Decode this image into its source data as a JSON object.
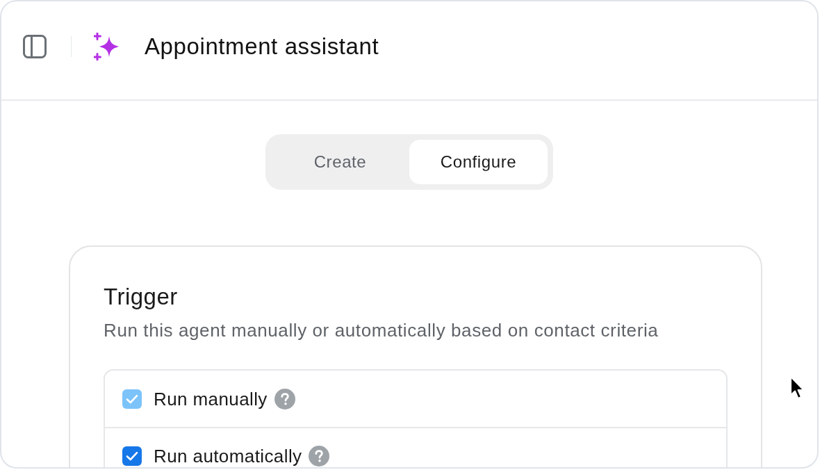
{
  "header": {
    "title": "Appointment assistant"
  },
  "tabs": [
    {
      "label": "Create",
      "selected": false
    },
    {
      "label": "Configure",
      "selected": true
    }
  ],
  "trigger": {
    "title": "Trigger",
    "description": "Run this agent manually or automatically based on contact criteria",
    "options": [
      {
        "label": "Run manually",
        "checked": true,
        "disabled": true
      },
      {
        "label": "Run automatically",
        "checked": true,
        "disabled": false
      }
    ]
  }
}
